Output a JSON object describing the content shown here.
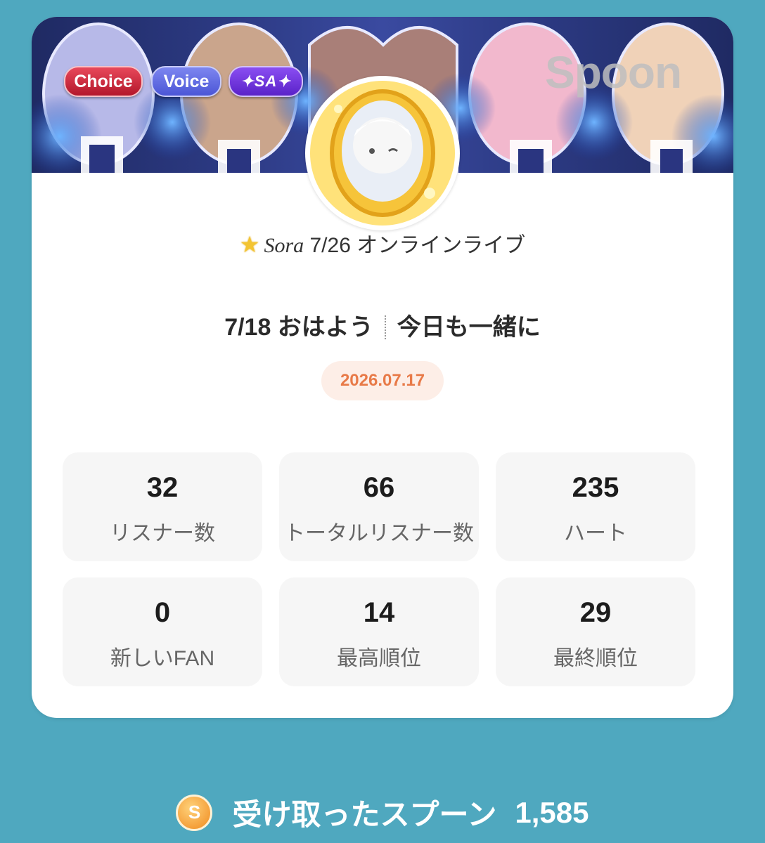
{
  "badges": [
    "Choice",
    "Voice",
    "✦SA✦"
  ],
  "banner_logo": "Spoon",
  "title": {
    "icon": "star-icon",
    "italic_name": "Sora",
    "text": " 7/26 オンラインライブ"
  },
  "subtitle": {
    "left": "7/18 おはよう",
    "right": "今日も一緒に"
  },
  "date": "2026.07.17",
  "stats": [
    {
      "value": "32",
      "label": "リスナー数"
    },
    {
      "value": "66",
      "label": "トータルリスナー数"
    },
    {
      "value": "235",
      "label": "ハート"
    },
    {
      "value": "0",
      "label": "新しいFAN"
    },
    {
      "value": "14",
      "label": "最高順位"
    },
    {
      "value": "29",
      "label": "最終順位"
    }
  ],
  "footer": {
    "icon": "spoon-coin-icon",
    "coin_letter": "S",
    "label": "受け取ったスプーン",
    "amount": "1,585"
  },
  "colors": {
    "background": "#4fa8bf",
    "date_text": "#e87a48",
    "date_bg": "#fdeee7"
  }
}
